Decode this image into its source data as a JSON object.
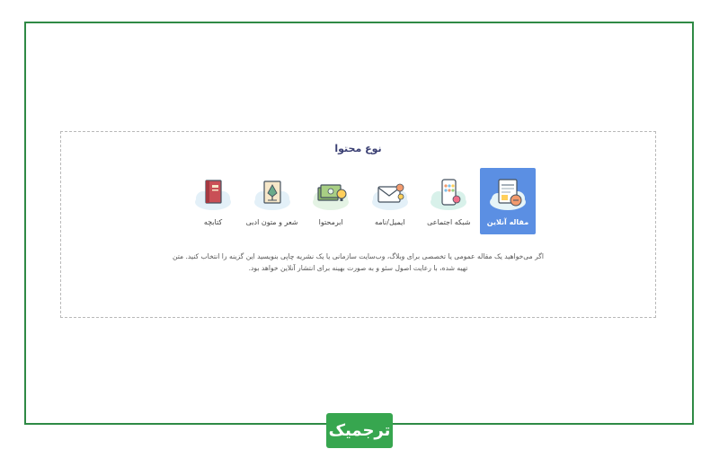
{
  "panel": {
    "title": "نوع محتوا",
    "options": [
      {
        "label": "مقاله آنلاین",
        "icon": "article-document-icon",
        "active": true
      },
      {
        "label": "شبکه اجتماعی",
        "icon": "mobile-social-icon",
        "active": false
      },
      {
        "label": "ایمیل/نامه",
        "icon": "email-envelope-icon",
        "active": false
      },
      {
        "label": "ابرمحتوا",
        "icon": "money-lightbulb-icon",
        "active": false
      },
      {
        "label": "شعر و متون ادبی",
        "icon": "poetry-quill-icon",
        "active": false
      },
      {
        "label": "کتابچه",
        "icon": "booklet-icon",
        "active": false
      }
    ],
    "description_line1": "اگر می‌خواهید یک مقاله عمومی یا تخصصی برای وبلاگ، وب‌سایت سازمانی یا یک نشریه چاپی بنویسید این گزینه را انتخاب کنید. متن",
    "description_line2": "تهیه شده، با رعایت اصول سئو و به صورت بهینه برای انتشار آنلاین خواهد بود."
  },
  "logo": {
    "text": "ترجمیک"
  },
  "colors": {
    "frame_border": "#2f8a45",
    "active_option": "#5b8fe3",
    "title": "#3a3f73",
    "logo_bg": "#37a64f"
  }
}
